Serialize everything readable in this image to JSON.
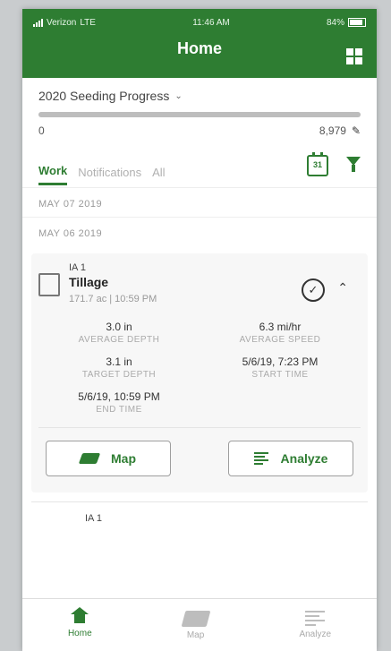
{
  "status": {
    "carrier": "Verizon",
    "network": "LTE",
    "time": "11:46 AM",
    "battery": "84%"
  },
  "header": {
    "title": "Home",
    "grid_icon": "grid-icon"
  },
  "progress": {
    "title": "2020 Seeding Progress",
    "min_label": "0",
    "max_label": "8,979",
    "fill_fraction": 1.0
  },
  "tabs": [
    {
      "label": "Work",
      "active": true
    },
    {
      "label": "Notifications",
      "active": false
    },
    {
      "label": "All",
      "active": false
    }
  ],
  "calendar_icon_text": "31",
  "dates": [
    "MAY 07 2019",
    "MAY 06 2019"
  ],
  "card": {
    "field": "IA 1",
    "operation": "Tillage",
    "meta": "171.7 ac | 10:59 PM",
    "stats": [
      {
        "value": "3.0 in",
        "label": "AVERAGE DEPTH"
      },
      {
        "value": "6.3 mi/hr",
        "label": "AVERAGE SPEED"
      },
      {
        "value": "3.1 in",
        "label": "TARGET DEPTH"
      },
      {
        "value": "5/6/19, 7:23 PM",
        "label": "START TIME"
      },
      {
        "value": "5/6/19, 10:59 PM",
        "label": "END TIME"
      }
    ],
    "map_button": "Map",
    "analyze_button": "Analyze"
  },
  "card2_field": "IA 1",
  "nav": [
    {
      "label": "Home",
      "icon": "home-icon",
      "active": true
    },
    {
      "label": "Map",
      "icon": "map-icon",
      "active": false
    },
    {
      "label": "Analyze",
      "icon": "analyze-icon",
      "active": false
    }
  ],
  "colors": {
    "brand": "#2e7d32"
  }
}
